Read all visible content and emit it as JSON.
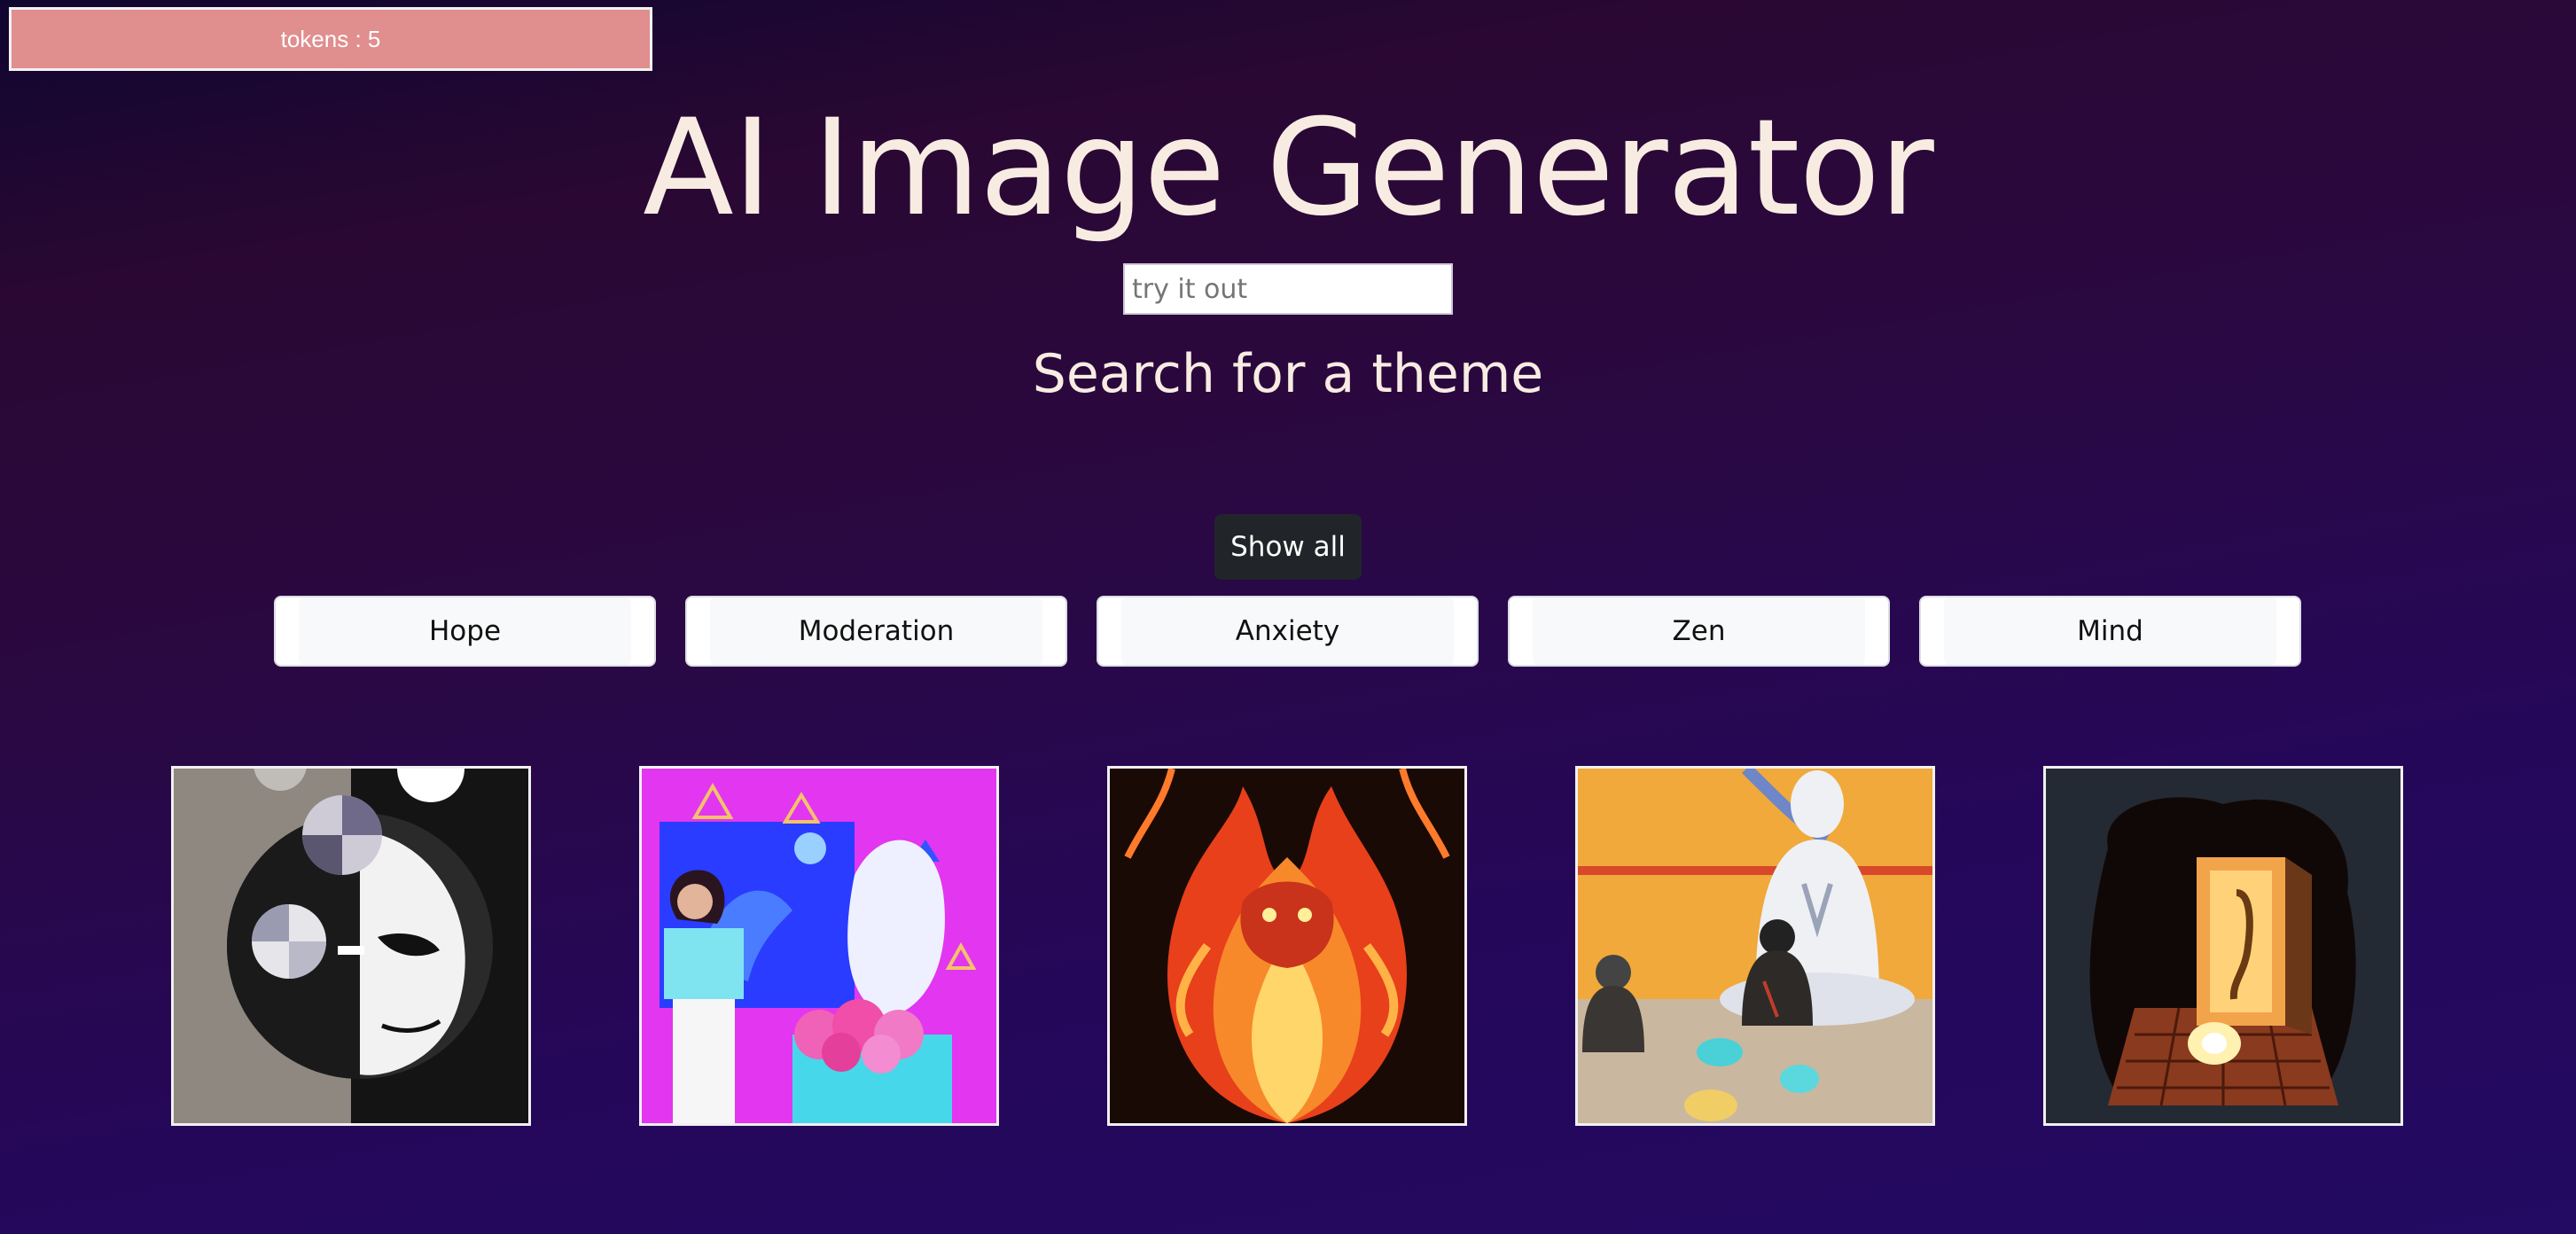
{
  "header": {
    "tokens_label": "tokens : 5"
  },
  "title": "AI Image Generator",
  "search": {
    "placeholder": "try it out",
    "value": ""
  },
  "subtitle": "Search for a theme",
  "filters": {
    "show_all_label": "Show all",
    "themes": [
      "Hope",
      "Moderation",
      "Anxiety",
      "Zen",
      "Mind"
    ]
  },
  "gallery": {
    "images": [
      {
        "icon": "split-face-image"
      },
      {
        "icon": "vaporwave-collage-image"
      },
      {
        "icon": "fire-demon-image"
      },
      {
        "icon": "meditating-monks-image"
      },
      {
        "icon": "glowing-doorway-image"
      }
    ]
  },
  "colors": {
    "token_bg": "#e08e8e",
    "title_text": "#f8ece2",
    "show_all_bg": "#212529",
    "theme_button_bg": "#f8f9fa"
  }
}
